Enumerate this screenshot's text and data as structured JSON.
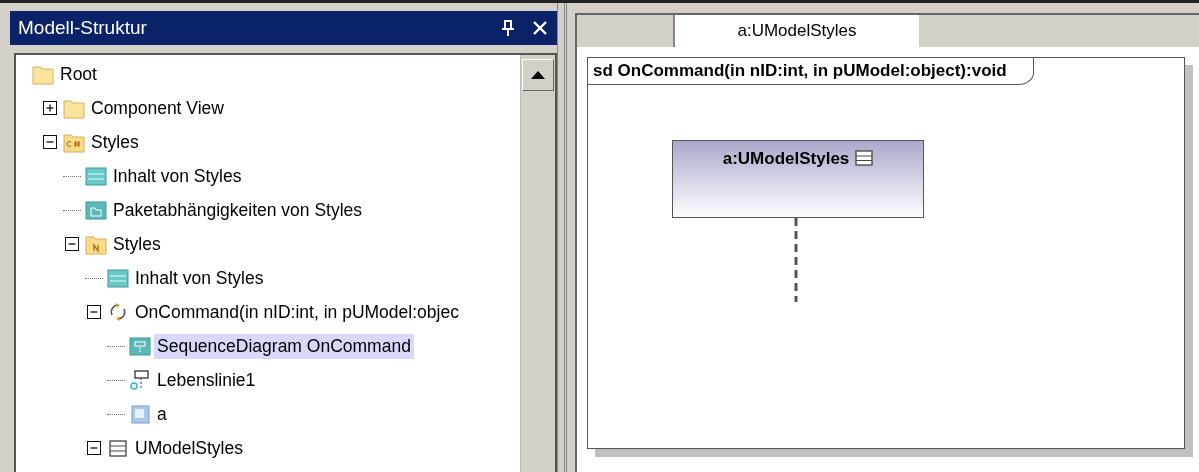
{
  "model_panel": {
    "title": "Modell-Struktur",
    "tree": [
      {
        "label": "Root",
        "kind": "folder",
        "selected": false,
        "children": [
          {
            "label": "Component View",
            "kind": "folder",
            "expanded": false,
            "selected": false
          },
          {
            "label": "Styles",
            "kind": "cspackage",
            "expanded": true,
            "selected": false,
            "children": [
              {
                "label": "Inhalt von Styles",
                "kind": "contentdiagram",
                "selected": false
              },
              {
                "label": "Paketabhängigkeiten von Styles",
                "kind": "packagediagram",
                "selected": false
              },
              {
                "label": "Styles",
                "kind": "namespace",
                "expanded": true,
                "selected": false,
                "children": [
                  {
                    "label": "Inhalt von Styles",
                    "kind": "contentdiagram",
                    "selected": false
                  },
                  {
                    "label": "OnCommand(in nID:int, in pUModel:objec",
                    "kind": "operation",
                    "expanded": true,
                    "selected": false,
                    "children": [
                      {
                        "label": "SequenceDiagram OnCommand",
                        "kind": "sequencediagram",
                        "selected": true
                      },
                      {
                        "label": "Lebenslinie1",
                        "kind": "lifeline",
                        "selected": false
                      },
                      {
                        "label": "a",
                        "kind": "instance",
                        "selected": false
                      }
                    ]
                  },
                  {
                    "label": "UModelStyles",
                    "kind": "class",
                    "expanded": true,
                    "selected": false
                  }
                ]
              }
            ]
          }
        ]
      }
    ]
  },
  "editor": {
    "tabs": [
      {
        "label": "a:UModelStyles",
        "selected": true
      }
    ],
    "diagram": {
      "frame_label": "sd OnCommand(in nID:int, in pUModel:object):void",
      "lifeline": {
        "label": "a:UModelStyles"
      }
    }
  }
}
